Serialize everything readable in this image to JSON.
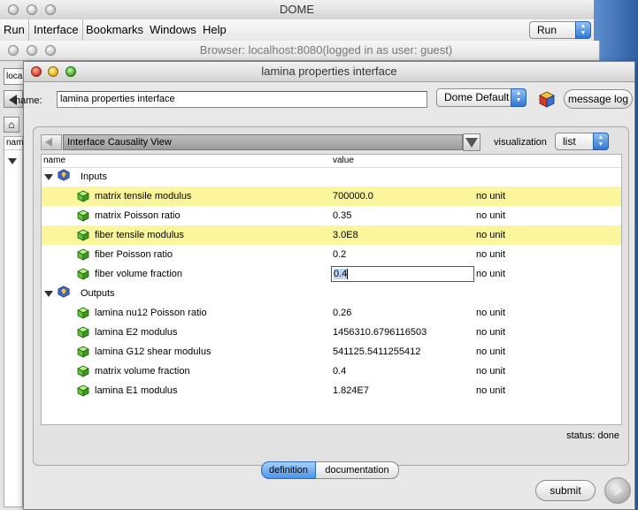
{
  "dome_window": {
    "title": "DOME",
    "menu": [
      "Run",
      "Interface",
      "Bookmarks",
      "Windows",
      "Help"
    ],
    "run_select": "Run"
  },
  "browser_window": {
    "title": "Browser: localhost:8080(logged in as user: guest)",
    "address_fragment": "loca",
    "name_fragment": "nam"
  },
  "interface_window": {
    "title": "lamina properties interface",
    "name_label": "name:",
    "name_value": "lamina properties interface",
    "view_select": "Dome Default",
    "message_log": "message log",
    "causality_view": "Interface Causality View",
    "visualization_label": "visualization",
    "visualization_select": "list",
    "columns": {
      "name": "name",
      "value": "value"
    },
    "inputs_label": "Inputs",
    "outputs_label": "Outputs",
    "inputs": [
      {
        "name": "matrix tensile modulus",
        "value": "700000.0",
        "unit": "no unit",
        "highlight": true
      },
      {
        "name": "matrix Poisson ratio",
        "value": "0.35",
        "unit": "no unit",
        "highlight": false
      },
      {
        "name": "fiber tensile modulus",
        "value": "3.0E8",
        "unit": "no unit",
        "highlight": true
      },
      {
        "name": "fiber Poisson ratio",
        "value": "0.2",
        "unit": "no unit",
        "highlight": false
      },
      {
        "name": "fiber volume fraction",
        "value": "0.4",
        "unit": "no unit",
        "highlight": false,
        "editing": true
      }
    ],
    "outputs": [
      {
        "name": "lamina nu12 Poisson ratio",
        "value": "0.26",
        "unit": "no unit"
      },
      {
        "name": "lamina E2 modulus",
        "value": "1456310.6796116503",
        "unit": "no unit"
      },
      {
        "name": "lamina G12 shear modulus",
        "value": "541125.5411255412",
        "unit": "no unit"
      },
      {
        "name": "matrix volume fraction",
        "value": "0.4",
        "unit": "no unit"
      },
      {
        "name": "lamina E1 modulus",
        "value": "1.824E7",
        "unit": "no unit"
      }
    ],
    "status": "status: done",
    "tabs": [
      "definition",
      "documentation"
    ],
    "submit": "submit"
  },
  "colors": {
    "highlight": "#fbf69b",
    "accent": "#3b82e0",
    "desktop": "#3a6fb5"
  }
}
